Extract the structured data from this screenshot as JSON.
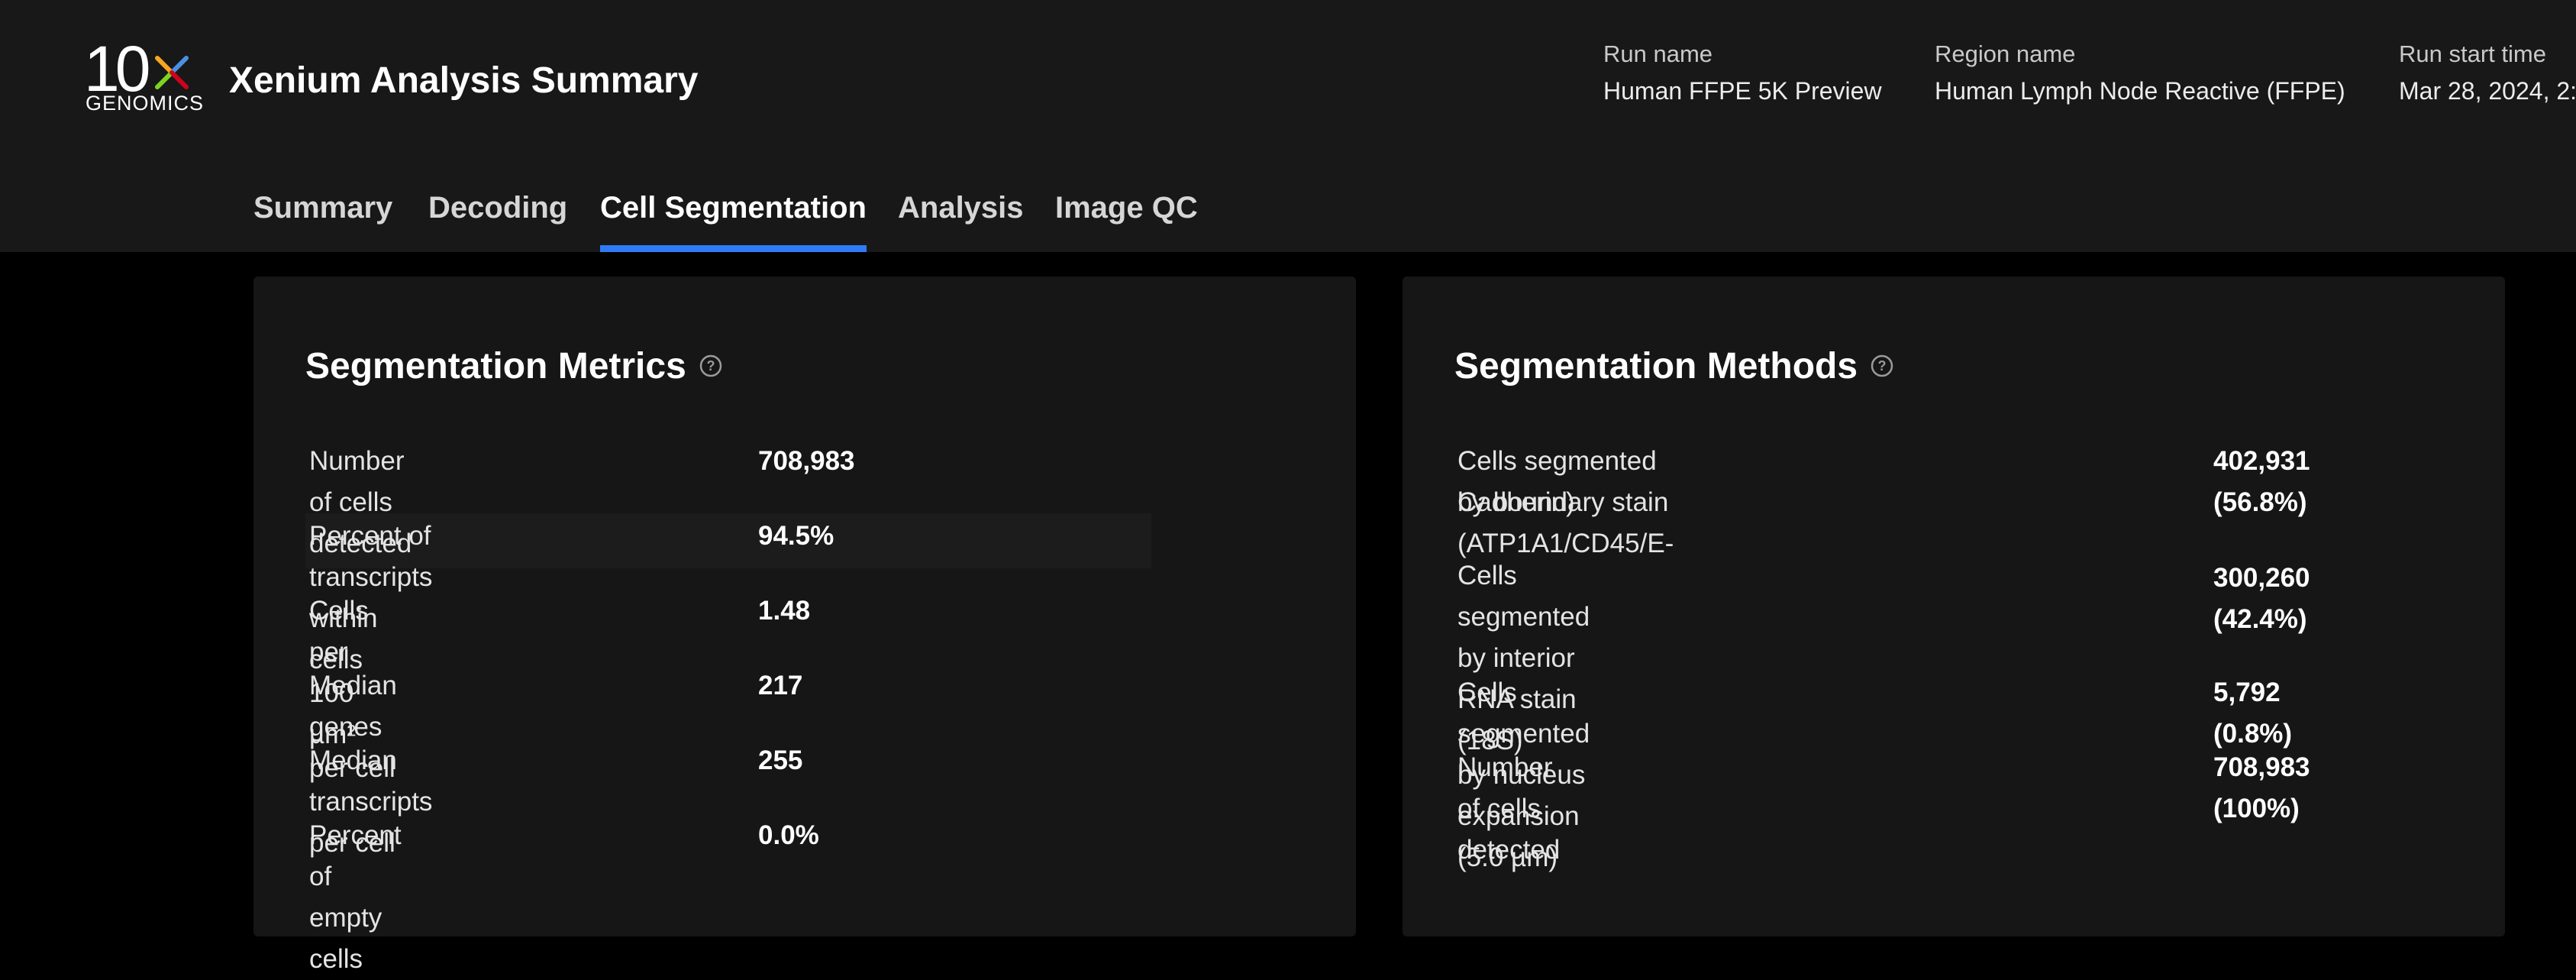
{
  "header": {
    "logo_main": "10x",
    "logo_sub": "GENOMICS",
    "title": "Xenium Analysis Summary",
    "run_name_label": "Run name",
    "run_name_value": "Human FFPE 5K Preview",
    "region_name_label": "Region name",
    "region_name_value": "Human Lymph Node Reactive (FFPE)",
    "run_start_label": "Run start time",
    "run_start_value": "Mar 28, 2024, 2:"
  },
  "tabs": [
    "Summary",
    "Decoding",
    "Cell Segmentation",
    "Analysis",
    "Image QC"
  ],
  "active_tab": "Cell Segmentation",
  "metrics": {
    "title": "Segmentation Metrics",
    "rows": [
      {
        "label": "Number of cells detected",
        "value": "708,983"
      },
      {
        "label": "Percent of transcripts within cells",
        "value": "94.5%"
      },
      {
        "label": "Cells per 100 µm²",
        "value": "1.48"
      },
      {
        "label": "Median genes per cell",
        "value": "217"
      },
      {
        "label": "Median transcripts per cell",
        "value": "255"
      },
      {
        "label": "Percent of empty cells",
        "value": "0.0%"
      }
    ]
  },
  "methods": {
    "title": "Segmentation Methods",
    "rows": [
      {
        "label_line1": "Cells segmented by boundary stain (ATP1A1/CD45/E-",
        "label_line2": "Cadherin)",
        "value_line1": "402,931",
        "value_line2": "(56.8%)"
      },
      {
        "label_line1": "Cells segmented by interior RNA stain (18S)",
        "label_line2": "",
        "value_line1": "300,260",
        "value_line2": "(42.4%)"
      },
      {
        "label_line1": "Cells segmented by nucleus expansion (5.0 µm)",
        "label_line2": "",
        "value_line1": "5,792 (0.8%)",
        "value_line2": ""
      },
      {
        "label_line1": "Number of cells detected",
        "label_line2": "",
        "value_line1": "708,983",
        "value_line2": "(100%)"
      }
    ]
  },
  "colors": {
    "accent": "#2f7bf5",
    "background": "#000000",
    "panel": "#161616",
    "header": "#181818"
  }
}
